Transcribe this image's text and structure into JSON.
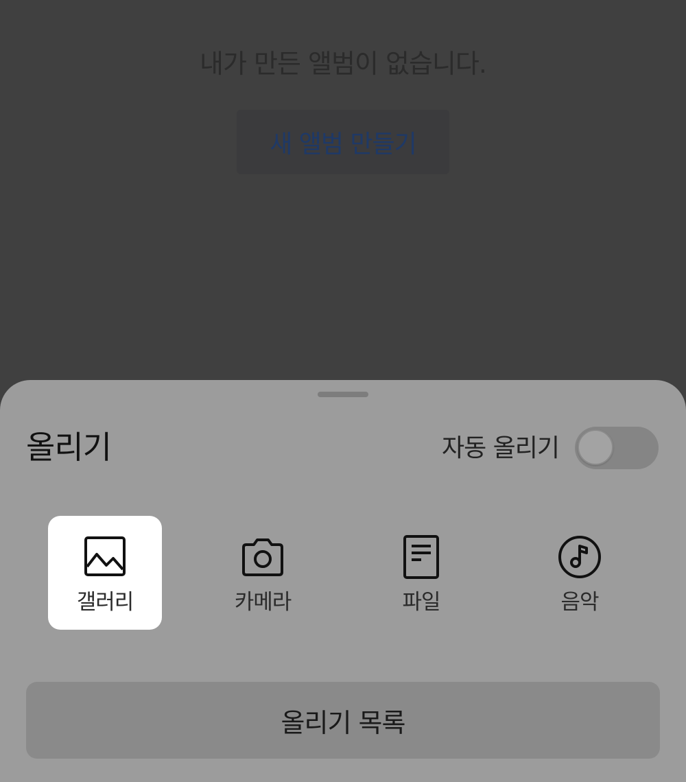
{
  "background": {
    "empty_message": "내가 만든 앨범이 없습니다.",
    "create_album_button": "새 앨범 만들기"
  },
  "sheet": {
    "title": "올리기",
    "auto_upload_label": "자동 올리기",
    "auto_upload_enabled": false,
    "sources": [
      {
        "label": "갤러리",
        "icon": "image-icon",
        "selected": true
      },
      {
        "label": "카메라",
        "icon": "camera-icon",
        "selected": false
      },
      {
        "label": "파일",
        "icon": "file-icon",
        "selected": false
      },
      {
        "label": "음악",
        "icon": "music-icon",
        "selected": false
      }
    ],
    "upload_list_button": "올리기 목록"
  },
  "colors": {
    "overlay_background": "#404040",
    "sheet_background": "#9c9c9c",
    "selected_tile": "#ffffff",
    "accent_text": "#1f3966"
  }
}
